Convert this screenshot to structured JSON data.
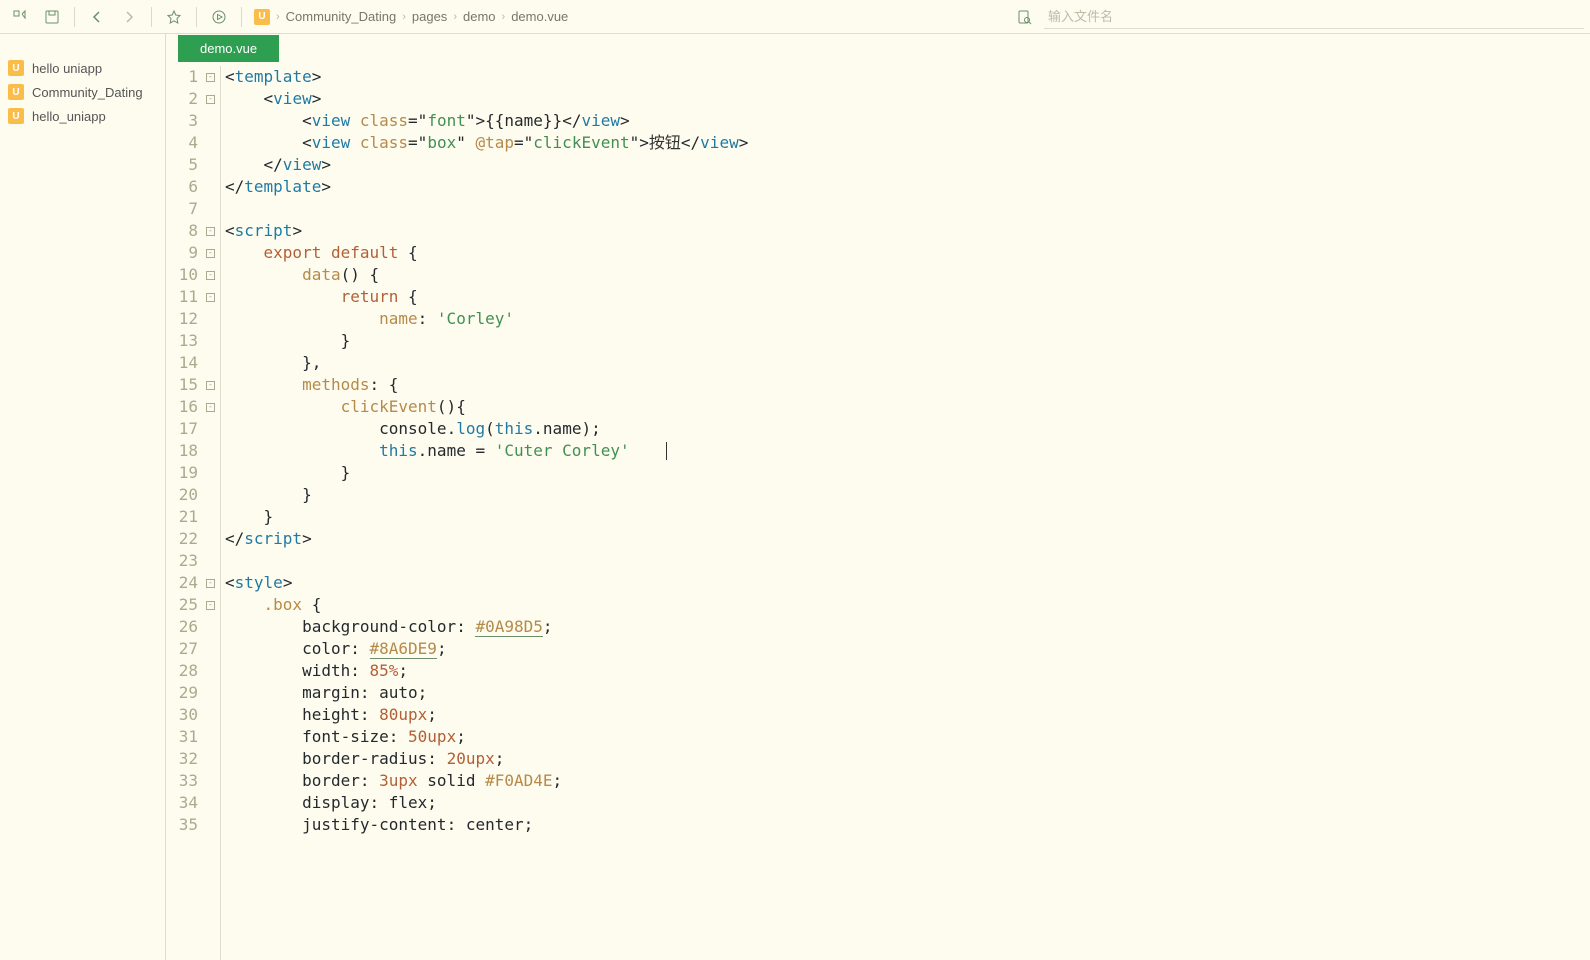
{
  "toolbar": {
    "search_placeholder": "输入文件名"
  },
  "breadcrumb": {
    "badge": "U",
    "items": [
      "Community_Dating",
      "pages",
      "demo",
      "demo.vue"
    ]
  },
  "sidebar": {
    "items": [
      {
        "label": "hello uniapp"
      },
      {
        "label": "Community_Dating"
      },
      {
        "label": "hello_uniapp"
      }
    ],
    "badge": "U"
  },
  "tabs": {
    "active": "demo.vue"
  },
  "code": {
    "lines": [
      {
        "n": 1,
        "fold": true
      },
      {
        "n": 2,
        "fold": true
      },
      {
        "n": 3
      },
      {
        "n": 4
      },
      {
        "n": 5
      },
      {
        "n": 6
      },
      {
        "n": 7
      },
      {
        "n": 8,
        "fold": true
      },
      {
        "n": 9,
        "fold": true
      },
      {
        "n": 10,
        "fold": true
      },
      {
        "n": 11,
        "fold": true
      },
      {
        "n": 12
      },
      {
        "n": 13
      },
      {
        "n": 14
      },
      {
        "n": 15,
        "fold": true
      },
      {
        "n": 16,
        "fold": true
      },
      {
        "n": 17
      },
      {
        "n": 18
      },
      {
        "n": 19
      },
      {
        "n": 20
      },
      {
        "n": 21
      },
      {
        "n": 22
      },
      {
        "n": 23
      },
      {
        "n": 24,
        "fold": true
      },
      {
        "n": 25,
        "fold": true
      },
      {
        "n": 26
      },
      {
        "n": 27
      },
      {
        "n": 28
      },
      {
        "n": 29
      },
      {
        "n": 30
      },
      {
        "n": 31
      },
      {
        "n": 32
      },
      {
        "n": 33
      },
      {
        "n": 34
      },
      {
        "n": 35
      }
    ],
    "tokens": {
      "l1": {
        "b1": "<",
        "tag1": "template",
        "b2": ">"
      },
      "l2": {
        "b1": "<",
        "tag": "view",
        "b2": ">"
      },
      "l3": {
        "b1": "<",
        "tag": "view",
        "sp": " ",
        "attr": "class",
        "eq": "=\"",
        "val": "font",
        "cq": "\"",
        "b2": ">",
        "bb1": "{{",
        "nm": "name",
        "bb2": "}}",
        "c1": "</",
        "c2": ">"
      },
      "l4": {
        "b1": "<",
        "tag": "view",
        "sp": " ",
        "attr1": "class",
        "eq1": "=\"",
        "val1": "box",
        "cq1": "\" ",
        "attr2": "@tap",
        "eq2": "=\"",
        "val2": "clickEvent",
        "cq2": "\"",
        "b2": ">",
        "txt": "按钮",
        "c1": "</",
        "c2": ">"
      },
      "l5": {
        "c1": "</",
        "tag": "view",
        "c2": ">"
      },
      "l6": {
        "c1": "</",
        "tag": "template",
        "c2": ">"
      },
      "l8": {
        "b1": "<",
        "tag": "script",
        "b2": ">"
      },
      "l9": {
        "kw1": "export",
        "sp": " ",
        "kw2": "default",
        "br": " {"
      },
      "l10": {
        "m": "data",
        "p": "() {"
      },
      "l11": {
        "kw": "return",
        "br": " {"
      },
      "l12": {
        "k": "name",
        "c": ": ",
        "v": "'Corley'"
      },
      "l13": {
        "br": "}"
      },
      "l14": {
        "br": "},"
      },
      "l15": {
        "k": "methods",
        "c": ": {"
      },
      "l16": {
        "m": "clickEvent",
        "p": "(){"
      },
      "l17": {
        "o": "console",
        "d": ".",
        "m": "log",
        "p1": "(",
        "th": "this",
        "d2": ".",
        "n": "name",
        "p2": ");"
      },
      "l18": {
        "th": "this",
        "d": ".",
        "n": "name",
        "eq": " = ",
        "v": "'Cuter Corley'"
      },
      "l19": {
        "br": "}"
      },
      "l20": {
        "br": "}"
      },
      "l21": {
        "br": "}"
      },
      "l22": {
        "c1": "</",
        "tag": "script",
        "c2": ">"
      },
      "l24": {
        "b1": "<",
        "tag": "style",
        "b2": ">"
      },
      "l25": {
        "sel": ".box",
        "br": " {"
      },
      "l26": {
        "p": "background-color",
        "c": ": ",
        "v": "#0A98D5",
        "s": ";"
      },
      "l27": {
        "p": "color",
        "c": ": ",
        "v": "#8A6DE9",
        "s": ";"
      },
      "l28": {
        "p": "width",
        "c": ": ",
        "v": "85%",
        "s": ";"
      },
      "l29": {
        "p": "margin",
        "c": ": ",
        "v": "auto",
        "s": ";"
      },
      "l30": {
        "p": "height",
        "c": ": ",
        "v": "80upx",
        "s": ";"
      },
      "l31": {
        "p": "font-size",
        "c": ": ",
        "v": "50upx",
        "s": ";"
      },
      "l32": {
        "p": "border-radius",
        "c": ": ",
        "v": "20upx",
        "s": ";"
      },
      "l33": {
        "p": "border",
        "c": ": ",
        "v1": "3upx",
        "v2": " solid ",
        "v3": "#F0AD4E",
        "s": ";"
      },
      "l34": {
        "p": "display",
        "c": ": ",
        "v": "flex",
        "s": ";"
      },
      "l35": {
        "p": "justify-content",
        "c": ": ",
        "v": "center",
        "s": ";"
      }
    }
  }
}
